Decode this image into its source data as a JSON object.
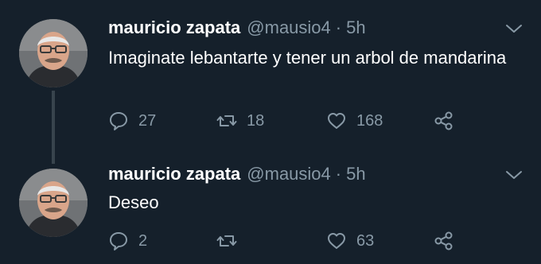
{
  "colors": {
    "background": "#15202b",
    "text_primary": "#ffffff",
    "text_secondary": "#8899a6",
    "thread_line": "#38444d"
  },
  "tweets": [
    {
      "display_name": "mauricio zapata",
      "handle": "@mausio4",
      "separator": "·",
      "time": "5h",
      "text": "Imaginate lebantarte y tener un arbol de mandarina",
      "reply_count": "27",
      "retweet_count": "18",
      "like_count": "168",
      "icons": [
        "avatar",
        "chevron-down-icon",
        "reply-icon",
        "retweet-icon",
        "like-icon",
        "share-icon"
      ]
    },
    {
      "display_name": "mauricio zapata",
      "handle": "@mausio4",
      "separator": "·",
      "time": "5h",
      "text": "Deseo",
      "reply_count": "2",
      "retweet_count": "",
      "like_count": "63",
      "icons": [
        "avatar",
        "chevron-down-icon",
        "reply-icon",
        "retweet-icon",
        "like-icon",
        "share-icon"
      ]
    }
  ]
}
